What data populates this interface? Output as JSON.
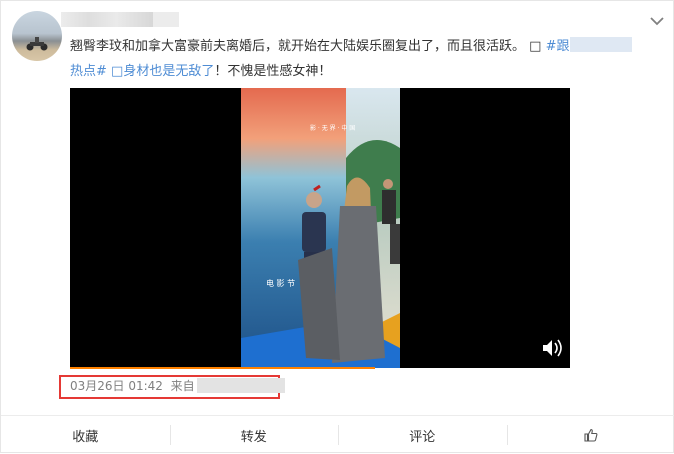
{
  "post": {
    "line1_main": "翘臀李玟和加拿大富豪前夫离婚后，就开始在大陆娱乐圈复出了，而且很活跃。",
    "line1_video_glyph": "□",
    "line1_tag_start": "#跟",
    "line2_tag_end": "热点#",
    "line2_video_glyph": "□",
    "line2_highlight": "身材也是无敌了",
    "line2_rest": "！不愧是性感女神！"
  },
  "video": {
    "sign_text_1": "影 · 无 界 · 中 国",
    "sign_text_2": "电 影 节"
  },
  "meta": {
    "time": "03月26日 01:42",
    "source_prefix": "来自"
  },
  "actions": [
    {
      "label": "收藏"
    },
    {
      "label": "转发"
    },
    {
      "label": "评论"
    }
  ],
  "colors": {
    "highlight": "#eb7350",
    "link": "#4e8cd4",
    "progress": "#ff8200",
    "annotation_box": "#e53935"
  },
  "icons": {
    "more": "chevron-down-icon",
    "volume": "volume-icon",
    "like": "thumbs-up-icon"
  }
}
